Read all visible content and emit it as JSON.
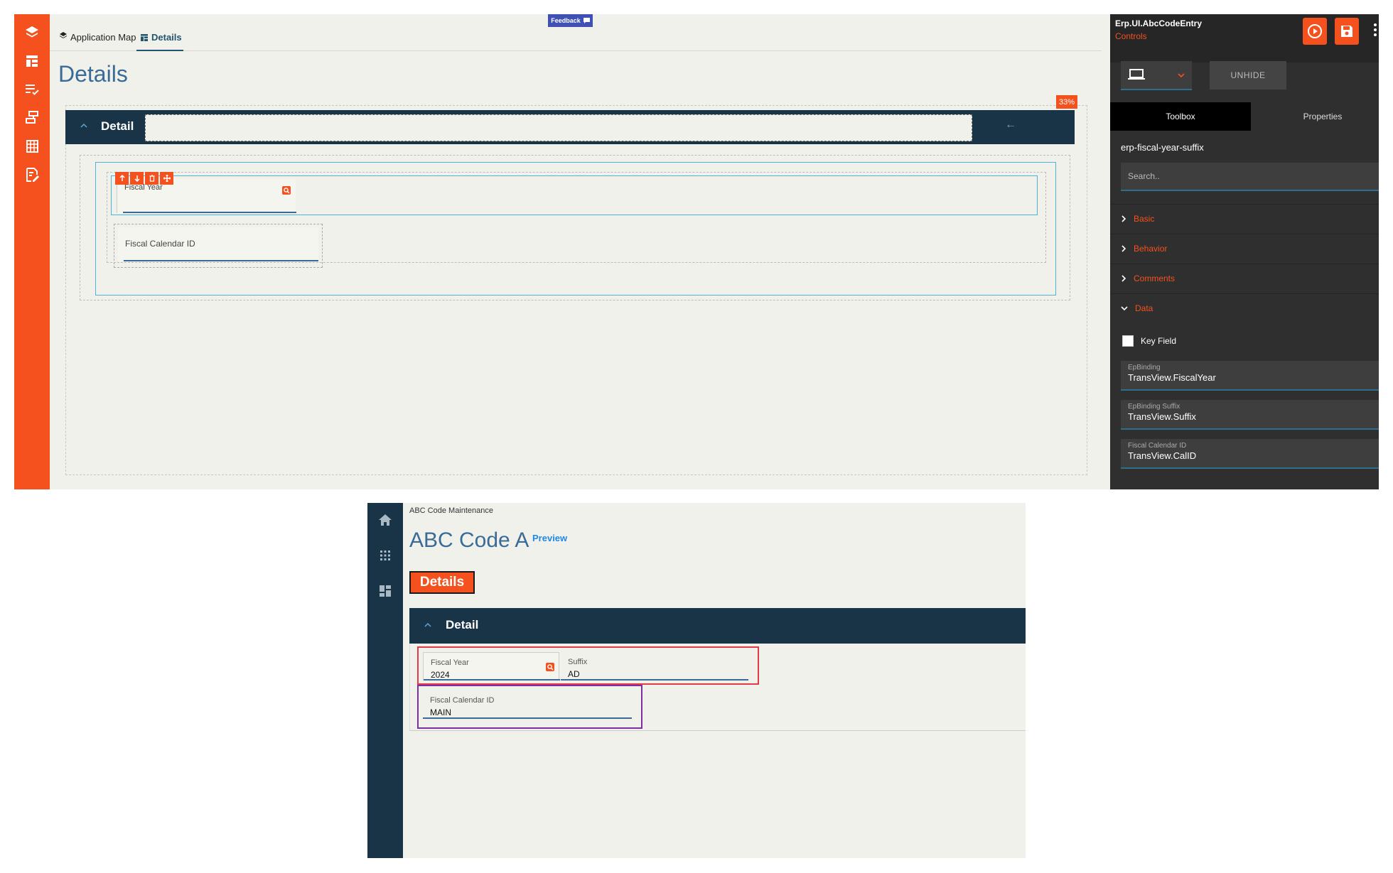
{
  "designer": {
    "tabs": [
      {
        "label": "Application Map",
        "icon": "cube-icon"
      },
      {
        "label": "Details",
        "icon": "table-icon"
      }
    ],
    "feedback_label": "Feedback",
    "page_title": "Details",
    "zoom_badge": "33%",
    "detail_header_label": "Detail",
    "back_arrow": "←",
    "fields": {
      "fiscal_year_label": "Fiscal Year",
      "fiscal_calendar_label": "Fiscal Calendar ID"
    }
  },
  "properties_panel": {
    "title": "Erp.UI.AbcCodeEntry",
    "subtitle": "Controls",
    "unhide_label": "UNHIDE",
    "tabs": [
      "Toolbox",
      "Properties"
    ],
    "control_id": "erp-fiscal-year-suffix",
    "search_placeholder": "Search..",
    "sections": [
      "Basic",
      "Behavior",
      "Comments",
      "Data"
    ],
    "key_field_label": "Key Field",
    "bindings": [
      {
        "label": "EpBinding",
        "value": "TransView.FiscalYear"
      },
      {
        "label": "EpBinding Suffix",
        "value": "TransView.Suffix"
      },
      {
        "label": "Fiscal Calendar ID",
        "value": "TransView.CalID"
      }
    ]
  },
  "runtime": {
    "breadcrumb": "ABC Code Maintenance",
    "title": "ABC Code A",
    "preview_label": "Preview",
    "details_tab": "Details",
    "detail_header_label": "Detail",
    "fields": [
      {
        "label": "Fiscal Year",
        "value": "2024"
      },
      {
        "label": "Suffix",
        "value": "AD"
      },
      {
        "label": "Fiscal Calendar ID",
        "value": "MAIN"
      }
    ]
  },
  "colors": {
    "accent_orange": "#f4511e",
    "navy": "#1a3447",
    "title_blue": "#3a6b96",
    "highlight_red": "#e53946",
    "highlight_purple": "#7b2fa3"
  }
}
